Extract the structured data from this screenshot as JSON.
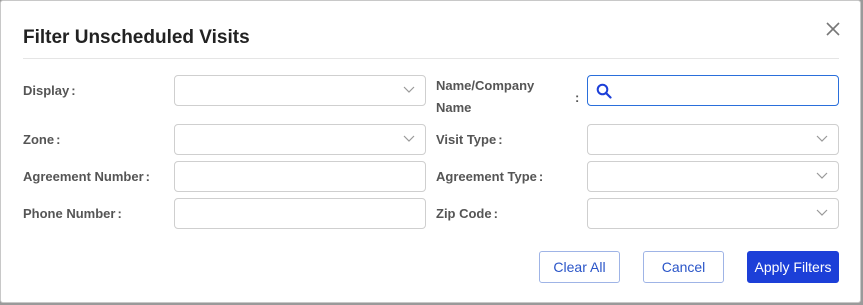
{
  "dialog": {
    "title": "Filter Unscheduled Visits",
    "close_icon": "close-icon"
  },
  "fields": {
    "display": {
      "label": "Display",
      "value": ""
    },
    "zone": {
      "label": "Zone",
      "value": ""
    },
    "agreement_number": {
      "label": "Agreement Number",
      "value": ""
    },
    "phone_number": {
      "label": "Phone Number",
      "value": ""
    },
    "name_company": {
      "label_line1": "Name/Company",
      "label_line2": "Name",
      "value": "",
      "icon": "search-icon"
    },
    "visit_type": {
      "label": "Visit Type",
      "value": ""
    },
    "agreement_type": {
      "label": "Agreement Type",
      "value": ""
    },
    "zip_code": {
      "label": "Zip Code",
      "value": ""
    }
  },
  "colon": ":",
  "buttons": {
    "clear_all": "Clear All",
    "cancel": "Cancel",
    "apply": "Apply Filters"
  },
  "colors": {
    "primary": "#1c3fd8",
    "focus_border": "#2a6fdb"
  }
}
